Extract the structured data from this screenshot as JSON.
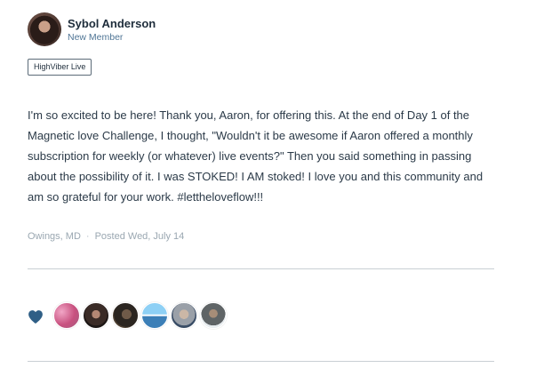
{
  "author": {
    "name": "Sybol Anderson",
    "role": "New Member"
  },
  "tag": "HighViber Live",
  "post": {
    "body": "I'm so excited to be here! Thank you, Aaron, for offering this. At the end of Day 1 of the Magnetic love Challenge, I thought, \"Wouldn't it be awesome if Aaron offered a monthly subscription for weekly (or whatever) live events?\" Then you said something in passing about the possibility of it. I was STOKED! I AM stoked! I love you and this community and am so grateful for your work. #lettheloveflow!!!",
    "location": "Owings, MD",
    "separator": "·",
    "posted": "Posted Wed, July 14"
  },
  "reactions": {
    "icon": "heart-icon",
    "color": "#2f5f86",
    "liker_count": 6
  }
}
